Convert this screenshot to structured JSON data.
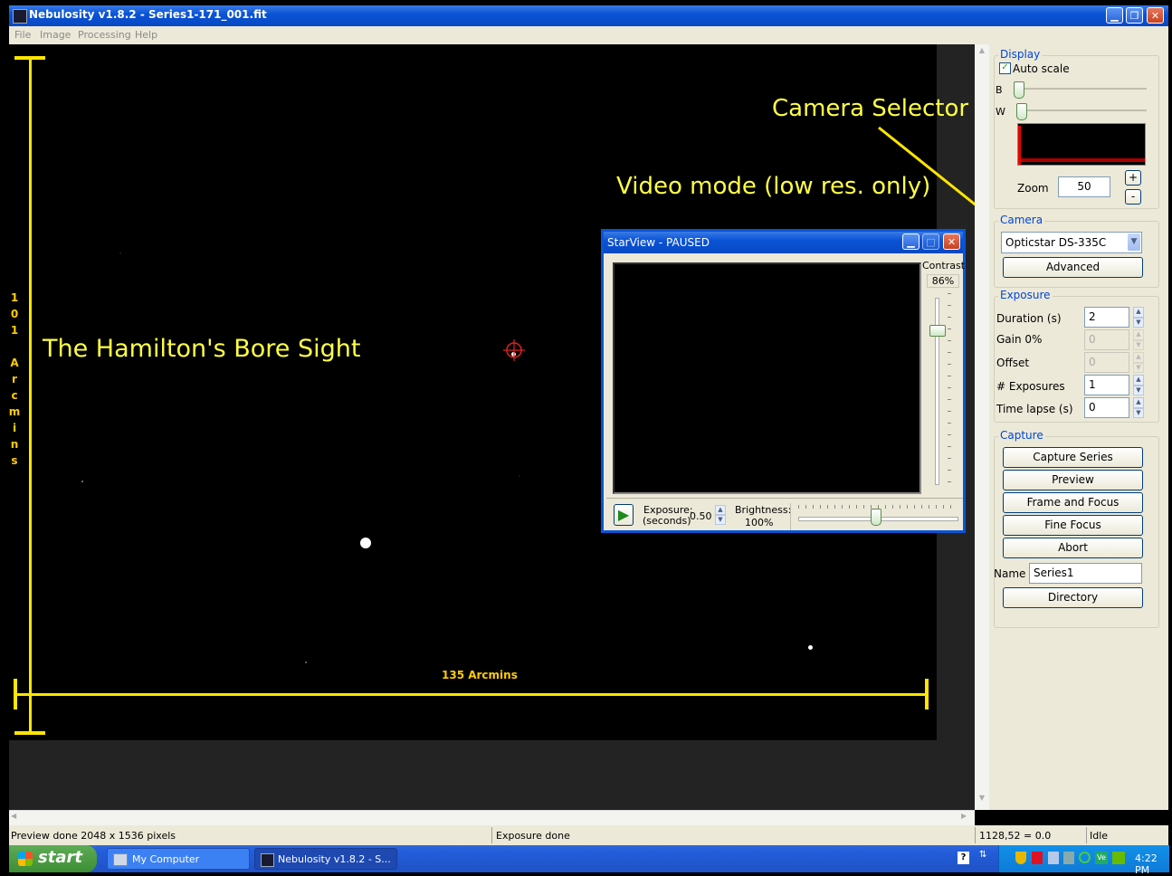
{
  "window": {
    "title": "Nebulosity v1.8.2 - Series1-171_001.fit"
  },
  "menu": [
    "File",
    "Image",
    "Processing",
    "Help"
  ],
  "annotations": {
    "bore_sight": "The Hamilton's Bore Sight",
    "vertical_chars": [
      "1",
      "0",
      "1",
      "",
      "A",
      "r",
      "c",
      "m",
      "i",
      "n",
      "s"
    ],
    "horizontal": "135 Arcmins",
    "camera_selector": "Camera Selector",
    "video_mode": "Video mode (low res. only)"
  },
  "display": {
    "label": "Display",
    "auto_scale": "Auto scale",
    "b_label": "B",
    "w_label": "W",
    "zoom_label": "Zoom",
    "zoom_value": "50",
    "zoom_plus": "+",
    "zoom_minus": "-"
  },
  "camera": {
    "label": "Camera",
    "selected": "Opticstar DS-335C",
    "advanced": "Advanced"
  },
  "exposure": {
    "label": "Exposure",
    "fields": [
      {
        "label": "Duration (s)",
        "value": "2"
      },
      {
        "label": "Gain 0%",
        "value": "0"
      },
      {
        "label": "Offset",
        "value": "0"
      },
      {
        "label": "# Exposures",
        "value": "1"
      },
      {
        "label": "Time lapse (s)",
        "value": "0"
      }
    ]
  },
  "capture": {
    "label": "Capture",
    "buttons": [
      "Capture Series",
      "Preview",
      "Frame and Focus",
      "Fine Focus",
      "Abort"
    ],
    "name_label": "Name",
    "name_value": "Series1",
    "directory": "Directory"
  },
  "starview": {
    "title": "StarView - PAUSED",
    "contrast_label": "Contrast",
    "contrast_value": "86%",
    "exposure_label": "Exposure:",
    "exposure_unit": "(seconds)",
    "exposure_value": "0.50",
    "brightness_label": "Brightness:",
    "brightness_value": "100%"
  },
  "status": {
    "left": "Preview done 2048 x 1536 pixels",
    "middle": "Exposure done",
    "coords": "1128,52 = 0.0",
    "state": "Idle"
  },
  "taskbar": {
    "start": "start",
    "tasks": [
      "My Computer",
      "Nebulosity v1.8.2 - S..."
    ],
    "clock": "4:22 PM"
  }
}
